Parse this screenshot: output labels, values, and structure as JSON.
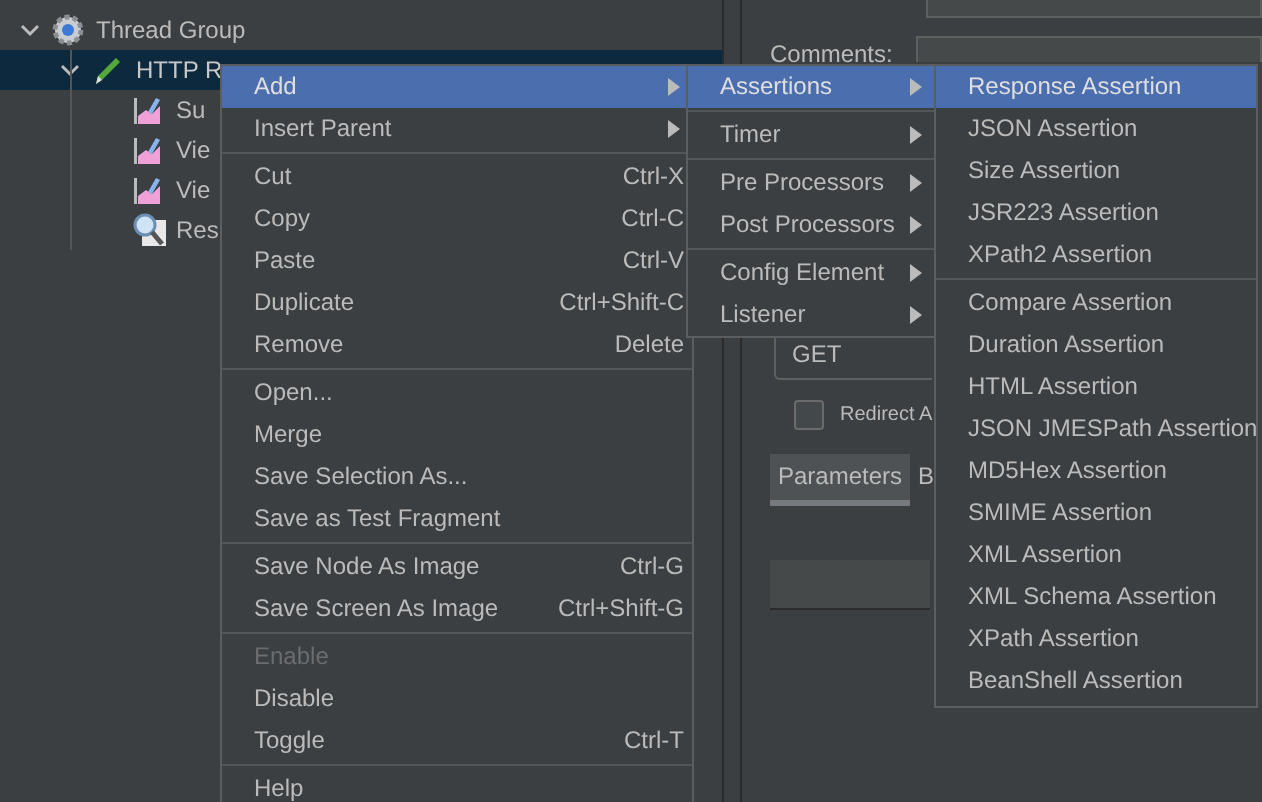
{
  "tree": [
    {
      "label": "Thread Group",
      "kind": "gear",
      "expanded": true,
      "selected": false,
      "children": [
        {
          "label": "HTTP R",
          "kind": "pencil",
          "expanded": true,
          "selected": true,
          "children": [
            {
              "label": "Su",
              "kind": "chart",
              "selected": false
            },
            {
              "label": "Vie",
              "kind": "chart",
              "selected": false
            },
            {
              "label": "Vie",
              "kind": "chart",
              "selected": false
            },
            {
              "label": "Res",
              "kind": "magnifier",
              "selected": false
            }
          ]
        }
      ]
    }
  ],
  "form": {
    "comments_label": "Comments:",
    "method": "GET",
    "redirect": {
      "label": "Redirect A",
      "checked": false
    },
    "tabs": [
      {
        "label": "Parameters",
        "selected": true
      },
      {
        "label": "B",
        "selected": false
      }
    ]
  },
  "context_menu": [
    {
      "label": "Add",
      "submenu": true,
      "selected": true
    },
    {
      "label": "Insert Parent",
      "submenu": true,
      "selected": false
    },
    {
      "label": "Cut",
      "shortcut": "Ctrl-X",
      "separator_before": true,
      "selected": false
    },
    {
      "label": "Copy",
      "shortcut": "Ctrl-C",
      "selected": false
    },
    {
      "label": "Paste",
      "shortcut": "Ctrl-V",
      "selected": false
    },
    {
      "label": "Duplicate",
      "shortcut": "Ctrl+Shift-C",
      "selected": false
    },
    {
      "label": "Remove",
      "shortcut": "Delete",
      "selected": false
    },
    {
      "label": "Open...",
      "separator_before": true,
      "selected": false
    },
    {
      "label": "Merge",
      "selected": false
    },
    {
      "label": "Save Selection As...",
      "selected": false
    },
    {
      "label": "Save as Test Fragment",
      "selected": false
    },
    {
      "label": "Save Node As Image",
      "shortcut": "Ctrl-G",
      "separator_before": true,
      "selected": false
    },
    {
      "label": "Save Screen As Image",
      "shortcut": "Ctrl+Shift-G",
      "selected": false
    },
    {
      "label": "Enable",
      "separator_before": true,
      "disabled": true,
      "selected": false
    },
    {
      "label": "Disable",
      "disabled": false,
      "selected": false
    },
    {
      "label": "Toggle",
      "shortcut": "Ctrl-T",
      "selected": false
    },
    {
      "label": "Help",
      "separator_before": true,
      "selected": false
    }
  ],
  "add_submenu": [
    {
      "label": "Assertions",
      "submenu": true,
      "selected": true
    },
    {
      "label": "Timer",
      "submenu": true,
      "separator_before": true,
      "selected": false
    },
    {
      "label": "Pre Processors",
      "submenu": true,
      "separator_before": true,
      "selected": false
    },
    {
      "label": "Post Processors",
      "submenu": true,
      "selected": false
    },
    {
      "label": "Config Element",
      "submenu": true,
      "separator_before": true,
      "selected": false
    },
    {
      "label": "Listener",
      "submenu": true,
      "selected": false
    }
  ],
  "assertions_submenu": [
    {
      "label": "Response Assertion",
      "selected": true
    },
    {
      "label": "JSON Assertion",
      "selected": false
    },
    {
      "label": "Size Assertion",
      "selected": false
    },
    {
      "label": "JSR223 Assertion",
      "selected": false
    },
    {
      "label": "XPath2 Assertion",
      "selected": false
    },
    {
      "label": "Compare Assertion",
      "separator_before": true,
      "selected": false
    },
    {
      "label": "Duration Assertion",
      "selected": false
    },
    {
      "label": "HTML Assertion",
      "selected": false
    },
    {
      "label": "JSON JMESPath Assertion",
      "selected": false
    },
    {
      "label": "MD5Hex Assertion",
      "selected": false
    },
    {
      "label": "SMIME Assertion",
      "selected": false
    },
    {
      "label": "XML Assertion",
      "selected": false
    },
    {
      "label": "XML Schema Assertion",
      "selected": false
    },
    {
      "label": "XPath Assertion",
      "selected": false
    },
    {
      "label": "BeanShell Assertion",
      "selected": false
    }
  ]
}
